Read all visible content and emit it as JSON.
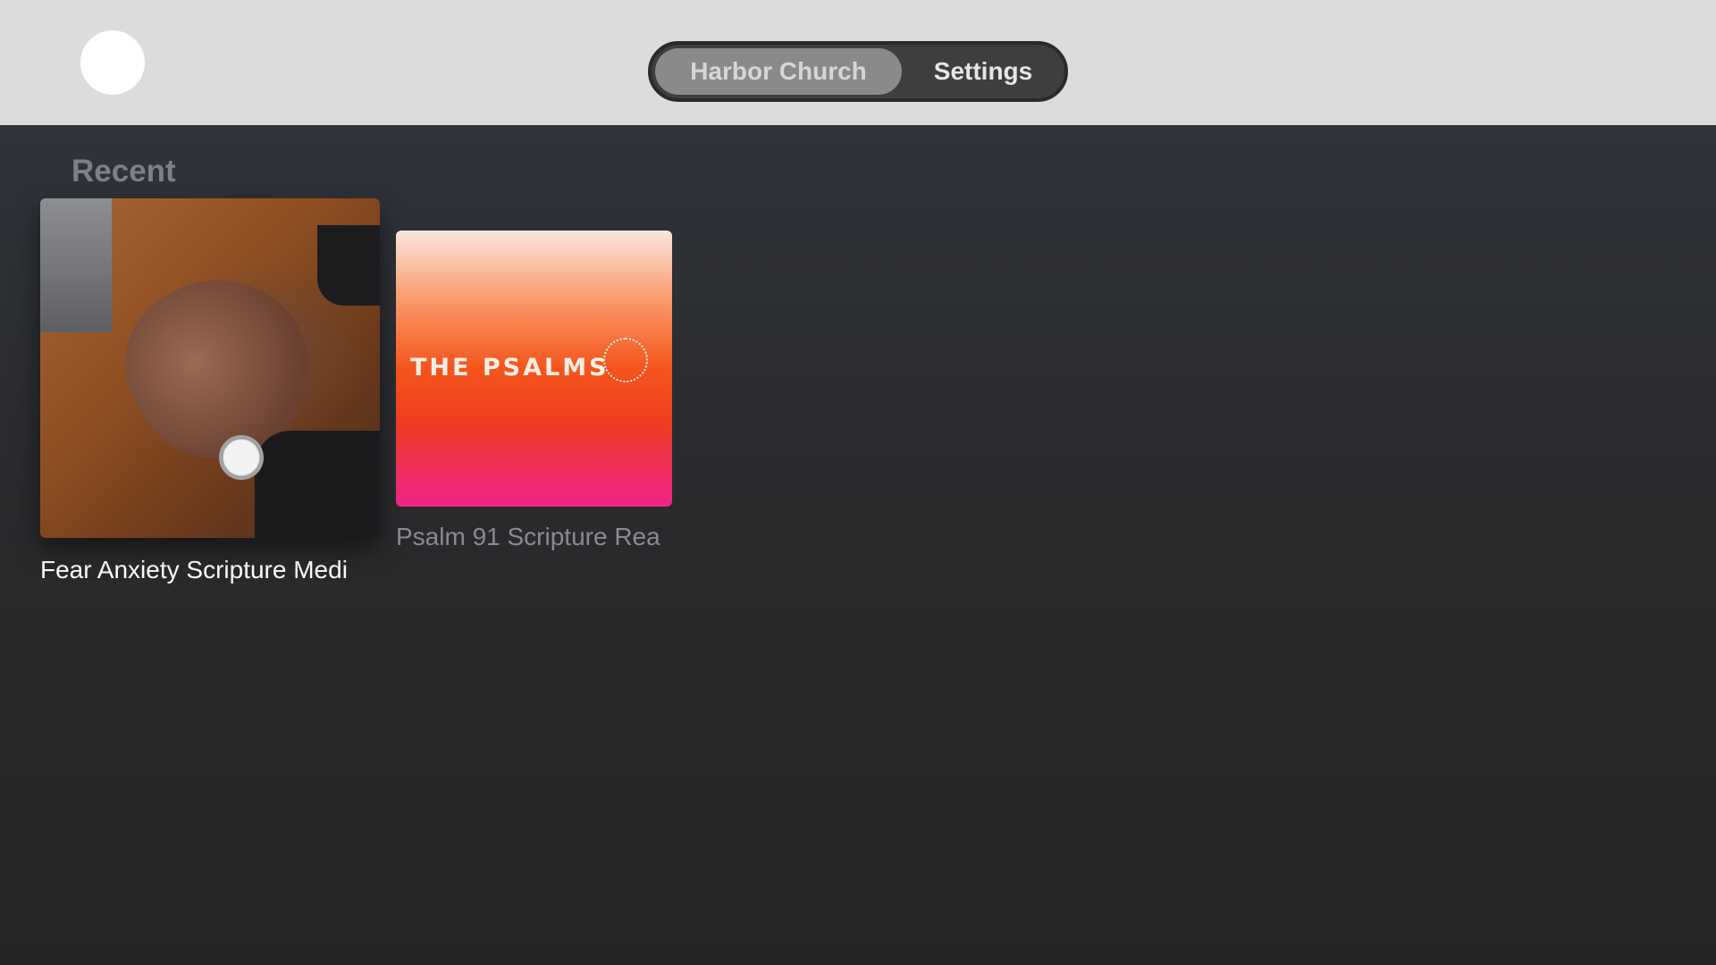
{
  "header": {
    "tabs": [
      {
        "label": "Harbor Church",
        "selected": true
      },
      {
        "label": "Settings",
        "selected": false
      }
    ]
  },
  "main": {
    "section_title": "Recent",
    "items": [
      {
        "title": "Fear Anxiety Scripture Medi",
        "focused": true
      },
      {
        "title": "Psalm 91 Scripture Rea",
        "focused": false,
        "artwork_text": "THE PSALMS"
      }
    ]
  }
}
